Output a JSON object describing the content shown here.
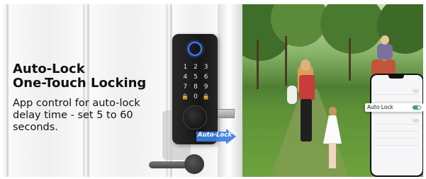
{
  "headline": {
    "line1": "Auto-Lock",
    "line2": "One-Touch Locking"
  },
  "description": "App control for auto-lock delay time - set 5 to 60 seconds.",
  "lock": {
    "keys": [
      "1",
      "2",
      "3",
      "4",
      "5",
      "6",
      "7",
      "8",
      "9",
      "🔒",
      "0",
      "🔒"
    ],
    "arrow_label": "Auto-Lock",
    "fingerprint_color": "#3b7dff"
  },
  "app": {
    "highlight_label": "Auto Lock",
    "toggle_color": "#3aa56a"
  },
  "colors": {
    "arrow": "#3f7ee0",
    "text": "#111111"
  }
}
